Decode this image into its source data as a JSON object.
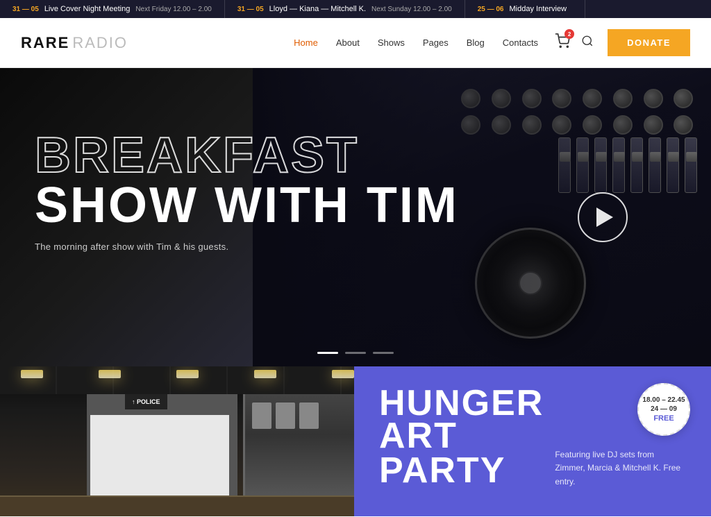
{
  "ticker": {
    "items": [
      {
        "date": "31 — 05",
        "title": "Live Cover Night Meeting",
        "time": "Next Friday 12.00 – 2.00"
      },
      {
        "date": "31 — 05",
        "title": "Lloyd — Kiana — Mitchell K.",
        "time": "Next Sunday 12.00 – 2.00"
      },
      {
        "date": "25 — 06",
        "title": "Midday Interview",
        "time": ""
      }
    ]
  },
  "header": {
    "logo_bold": "RARE",
    "logo_light": "RADIO",
    "nav": [
      {
        "label": "Home",
        "active": true
      },
      {
        "label": "About"
      },
      {
        "label": "Shows"
      },
      {
        "label": "Pages"
      },
      {
        "label": "Blog"
      },
      {
        "label": "Contacts"
      }
    ],
    "cart_count": "2",
    "donate_label": "DONATE"
  },
  "hero": {
    "title_outline": "BREAKFAST",
    "title_solid_part1": "SHOW ",
    "title_solid_part2": "WITH TIM",
    "subtitle": "The morning after show with Tim & his guests.",
    "dots": [
      {
        "active": true
      },
      {
        "active": false
      },
      {
        "active": false
      }
    ]
  },
  "bottom_left": {
    "police_sign": "↑ POLICE"
  },
  "bottom_right": {
    "badge_time": "18.00 – 22.45",
    "badge_date": "24 — 09",
    "badge_free": "FREE",
    "event_name": "HUNGER ART",
    "event_party": "PARTY",
    "event_desc": "Featuring live DJ sets from Zimmer, Marcia & Mitchell K. Free entry."
  }
}
